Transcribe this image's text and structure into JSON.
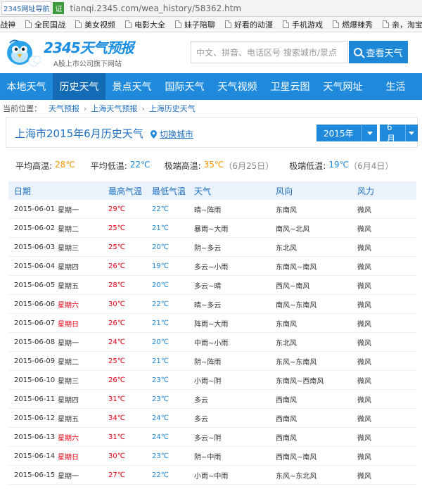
{
  "browser": {
    "site_tag": "2345网址导航",
    "cert": "证",
    "url": "tianqi.2345.com/wea_history/58362.htm"
  },
  "bookmarks": [
    "战神",
    "全民国战",
    "美女视频",
    "电影大全",
    "妹子陪聊",
    "好看的动漫",
    "手机游戏",
    "燃爆辣秀",
    "亲，淘宝"
  ],
  "header": {
    "logo_text": "2345天气预报",
    "logo_sub": "A股上市公司旗下网站",
    "search_placeholder": "中文、拼音、电话区号 搜索城市/景点",
    "search_button": "查看天气"
  },
  "nav": [
    "本地天气",
    "历史天气",
    "景点天气",
    "国际天气",
    "天气视频",
    "卫星云图",
    "天气网址",
    "生活"
  ],
  "nav_active": 1,
  "breadcrumb": {
    "label": "当前位置：",
    "items": [
      "天气预报",
      "上海天气预报",
      "上海历史天气"
    ]
  },
  "title": {
    "text": "上海市2015年6月历史天气",
    "switch_city": "切换城市",
    "year": "2015年",
    "month": "6月"
  },
  "summary": {
    "avg_high_label": "平均高温:",
    "avg_high": "28℃",
    "avg_low_label": "平均低温:",
    "avg_low": "22℃",
    "max_high_label": "极端高温:",
    "max_high": "35℃",
    "max_high_date": "（6月25日）",
    "min_low_label": "极端低温:",
    "min_low": "19℃",
    "min_low_date": "（6月4日）"
  },
  "table": {
    "headers": [
      "日期",
      "最高气温",
      "最低气温",
      "天气",
      "风向",
      "风力"
    ],
    "rows": [
      [
        "2015-06-01",
        "星期一",
        "29℃",
        "22℃",
        "晴~阵雨",
        "东南风",
        "微风"
      ],
      [
        "2015-06-02",
        "星期二",
        "25℃",
        "21℃",
        "暴雨~大雨",
        "南风~北风",
        "微风"
      ],
      [
        "2015-06-03",
        "星期三",
        "25℃",
        "20℃",
        "阴~多云",
        "东北风",
        "微风"
      ],
      [
        "2015-06-04",
        "星期四",
        "26℃",
        "19℃",
        "多云~小雨",
        "东南风~南风",
        "微风"
      ],
      [
        "2015-06-05",
        "星期五",
        "28℃",
        "20℃",
        "多云~晴",
        "西风~南风",
        "微风"
      ],
      [
        "2015-06-06",
        "星期六",
        "30℃",
        "22℃",
        "晴~多云",
        "南风~东南风",
        "微风"
      ],
      [
        "2015-06-07",
        "星期日",
        "26℃",
        "21℃",
        "阵雨~大雨",
        "东南风",
        "微风"
      ],
      [
        "2015-06-08",
        "星期一",
        "24℃",
        "20℃",
        "中雨~小雨",
        "东北风",
        "微风"
      ],
      [
        "2015-06-09",
        "星期二",
        "25℃",
        "21℃",
        "阴~阵雨",
        "东风~东南风",
        "微风"
      ],
      [
        "2015-06-10",
        "星期三",
        "26℃",
        "23℃",
        "小雨~阴",
        "东南风~西南风",
        "微风"
      ],
      [
        "2015-06-11",
        "星期四",
        "31℃",
        "23℃",
        "多云",
        "西南风",
        "微风"
      ],
      [
        "2015-06-12",
        "星期五",
        "34℃",
        "24℃",
        "多云",
        "西南风",
        "微风"
      ],
      [
        "2015-06-13",
        "星期六",
        "31℃",
        "24℃",
        "多云~阴",
        "西南风",
        "微风"
      ],
      [
        "2015-06-14",
        "星期日",
        "30℃",
        "23℃",
        "阴~中雨",
        "西南风~南风",
        "微风"
      ],
      [
        "2015-06-15",
        "星期一",
        "27℃",
        "22℃",
        "小雨~中雨",
        "东风~东北风",
        "微风"
      ]
    ]
  },
  "colors": {
    "brand_blue": "#1f8adb",
    "nav_active": "#136bb5",
    "hot_red": "#e60012",
    "cold_blue": "#1e88d8",
    "accent_orange": "#f39800"
  },
  "icons": {
    "logo": "cartoon-bird-logo-icon",
    "search": "magnifier-icon",
    "switch_city": "location-pin-icon",
    "bookmark": "page-icon"
  }
}
